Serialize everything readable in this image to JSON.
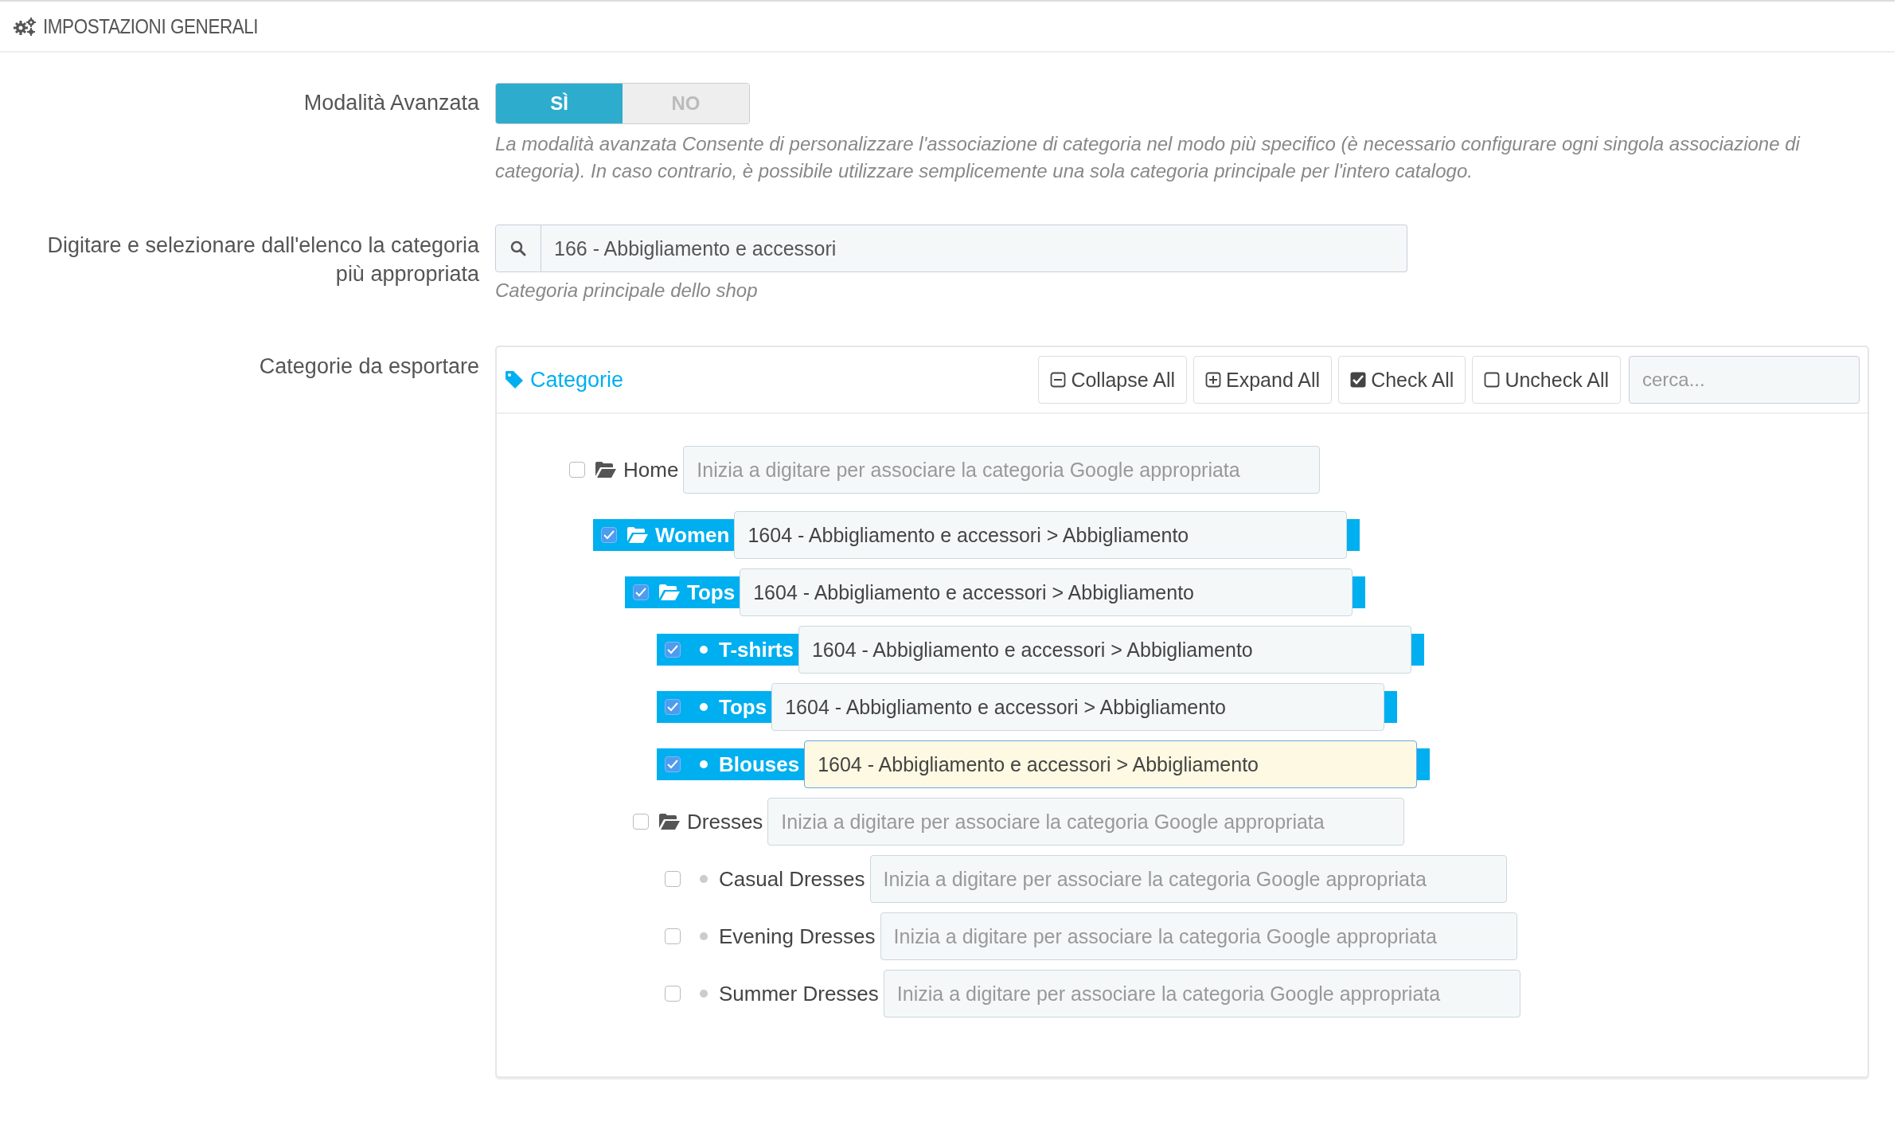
{
  "header": {
    "title": "IMPOSTAZIONI GENERALI"
  },
  "advanced_mode": {
    "label": "Modalità Avanzata",
    "options": [
      {
        "label": "SÌ",
        "selected": true
      },
      {
        "label": "NO",
        "selected": false
      }
    ],
    "help": "La modalità avanzata Consente di personalizzare l'associazione di categoria nel modo più specifico (è necessario configurare ogni singola associazione di categoria). In caso contrario, è possibile utilizzare semplicemente una sola categoria principale per l'intero catalogo."
  },
  "main_category": {
    "label": "Digitare e selezionare dall'elenco la categoria più appropriata",
    "value": "166 - Abbigliamento e accessori",
    "help": "Categoria principale dello shop"
  },
  "export_categories": {
    "label": "Categorie da esportare",
    "panel_title": "Categorie",
    "toolbar": [
      {
        "label": "Collapse All",
        "kind": "minus"
      },
      {
        "label": "Expand All",
        "kind": "plus"
      },
      {
        "label": "Check All",
        "kind": "check"
      },
      {
        "label": "Uncheck All",
        "kind": "uncheck"
      }
    ],
    "search": {
      "placeholder": "cerca..."
    },
    "tree": [
      {
        "label": "Home",
        "kind": "folder",
        "checked": false,
        "focused": false,
        "placeholder": "Inizia a digitare per associare la categoria Google appropriata",
        "children": [
          {
            "label": "Women",
            "kind": "folder",
            "checked": true,
            "focused": false,
            "value": "1604 - Abbigliamento e accessori > Abbigliamento",
            "children": [
              {
                "label": "Tops",
                "kind": "folder",
                "checked": true,
                "focused": false,
                "value": "1604 - Abbigliamento e accessori > Abbigliamento",
                "children": [
                  {
                    "label": "T-shirts",
                    "kind": "leaf",
                    "checked": true,
                    "focused": false,
                    "value": "1604 - Abbigliamento e accessori > Abbigliamento"
                  },
                  {
                    "label": "Tops",
                    "kind": "leaf",
                    "checked": true,
                    "focused": false,
                    "value": "1604 - Abbigliamento e accessori > Abbigliamento"
                  },
                  {
                    "label": "Blouses",
                    "kind": "leaf",
                    "checked": true,
                    "focused": true,
                    "value": "1604 - Abbigliamento e accessori > Abbigliamento"
                  }
                ]
              },
              {
                "label": "Dresses",
                "kind": "folder",
                "checked": false,
                "focused": false,
                "placeholder": "Inizia a digitare per associare la categoria Google appropriata",
                "children": [
                  {
                    "label": "Casual Dresses",
                    "kind": "leaf",
                    "checked": false,
                    "focused": false,
                    "placeholder": "Inizia a digitare per associare la categoria Google appropriata"
                  },
                  {
                    "label": "Evening Dresses",
                    "kind": "leaf",
                    "checked": false,
                    "focused": false,
                    "placeholder": "Inizia a digitare per associare la categoria Google appropriata"
                  },
                  {
                    "label": "Summer Dresses",
                    "kind": "leaf",
                    "checked": false,
                    "focused": false,
                    "placeholder": "Inizia a digitare per associare la categoria Google appropriata"
                  }
                ]
              }
            ]
          }
        ]
      }
    ]
  }
}
